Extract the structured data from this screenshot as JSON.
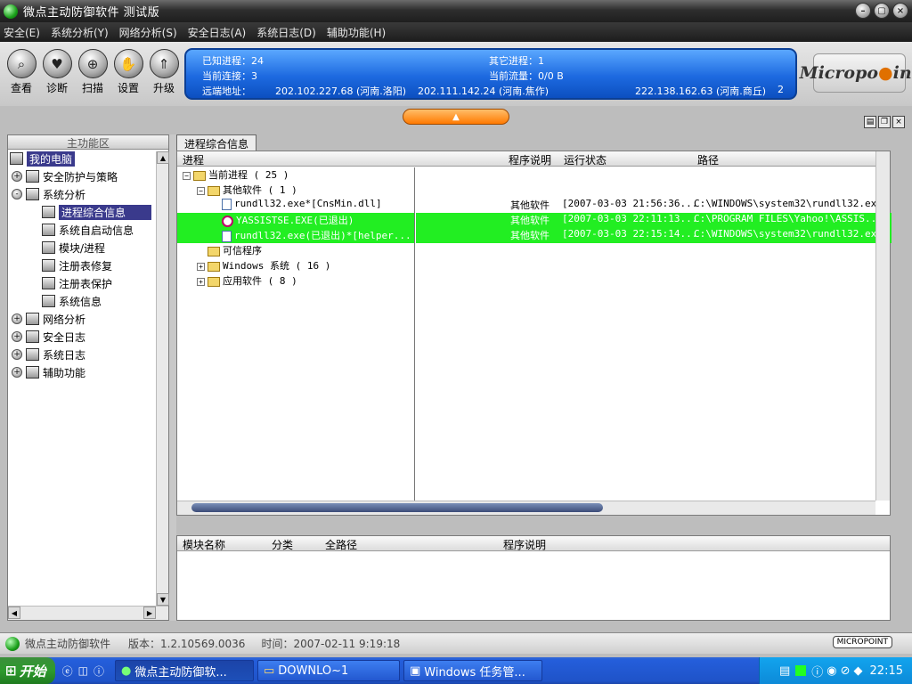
{
  "window": {
    "title": "微点主动防御软件  测试版"
  },
  "menu": [
    "安全(E)",
    "系统分析(Y)",
    "网络分析(S)",
    "安全日志(A)",
    "系统日志(D)",
    "辅助功能(H)"
  ],
  "tools": [
    {
      "label": "查看",
      "icon": "magnifier-icon"
    },
    {
      "label": "诊断",
      "icon": "heart-icon"
    },
    {
      "label": "扫描",
      "icon": "scan-icon"
    },
    {
      "label": "设置",
      "icon": "hand-icon"
    },
    {
      "label": "升级",
      "icon": "upgrade-icon"
    }
  ],
  "info": {
    "known_procs": "已知进程：24",
    "other_procs": "其它进程：1",
    "cur_conn": "当前连接：3",
    "cur_traffic": "当前流量：0/0 B",
    "remote_label": "远端地址：",
    "remote1": "202.102.227.68 (河南.洛阳)",
    "remote2": "202.111.142.24 (河南.焦作)",
    "remote3": "222.138.162.63 (河南.商丘)",
    "remote_count": "2"
  },
  "logo": "Micropoint",
  "left_panel": {
    "title": "主功能区",
    "items": [
      {
        "label": "我的电脑",
        "level": 0,
        "expander": "",
        "selected_root": true
      },
      {
        "label": "安全防护与策略",
        "level": 1,
        "expander": "+"
      },
      {
        "label": "系统分析",
        "level": 1,
        "expander": "-"
      },
      {
        "label": "进程综合信息",
        "level": 2,
        "expander": "",
        "selected": true
      },
      {
        "label": "系统自启动信息",
        "level": 2,
        "expander": ""
      },
      {
        "label": "模块/进程",
        "level": 2,
        "expander": ""
      },
      {
        "label": "注册表修复",
        "level": 2,
        "expander": ""
      },
      {
        "label": "注册表保护",
        "level": 2,
        "expander": ""
      },
      {
        "label": "系统信息",
        "level": 2,
        "expander": ""
      },
      {
        "label": "网络分析",
        "level": 1,
        "expander": "+"
      },
      {
        "label": "安全日志",
        "level": 1,
        "expander": "+"
      },
      {
        "label": "系统日志",
        "level": 1,
        "expander": "+"
      },
      {
        "label": "辅助功能",
        "level": 1,
        "expander": "+"
      }
    ]
  },
  "tab": "进程综合信息",
  "proc_headers": [
    "进程",
    "程序说明",
    "运行状态",
    "路径"
  ],
  "proc_tree": [
    {
      "label": "当前进程 ( 25 )",
      "indent": 0,
      "exp": "-",
      "type": "folder"
    },
    {
      "label": "其他软件 ( 1 )",
      "indent": 1,
      "exp": "-",
      "type": "folder"
    },
    {
      "label": "rundll32.exe*[CnsMin.dll]",
      "indent": 2,
      "exp": "",
      "type": "file",
      "green": false,
      "desc": "其他软件",
      "status": "[2007-03-03 21:56:36...",
      "path": "C:\\WINDOWS\\system32\\rundll32.exe"
    },
    {
      "label": "YASSISTSE.EXE(已退出)",
      "indent": 2,
      "exp": "",
      "type": "stop",
      "green": true,
      "desc": "其他软件",
      "status": "[2007-03-03 22:11:13...",
      "path": "C:\\PROGRAM FILES\\Yahoo!\\ASSIS..."
    },
    {
      "label": "rundll32.exe(已退出)*[helper...",
      "indent": 2,
      "exp": "",
      "type": "file",
      "green": true,
      "desc": "其他软件",
      "status": "[2007-03-03 22:15:14...",
      "path": "C:\\WINDOWS\\system32\\rundll32.exe"
    },
    {
      "label": "可信程序",
      "indent": 1,
      "exp": "",
      "type": "folder"
    },
    {
      "label": "Windows 系统 ( 16 )",
      "indent": 1,
      "exp": "+",
      "type": "folder"
    },
    {
      "label": "应用软件 ( 8 )",
      "indent": 1,
      "exp": "+",
      "type": "folder"
    }
  ],
  "module_headers": [
    "模块名称",
    "分类",
    "全路径",
    "程序说明"
  ],
  "status": {
    "app": "微点主动防御软件",
    "version": "版本：1.2.10569.0036",
    "time": "时间：2007-02-11 9:19:18",
    "badge": "MICROPOINT"
  },
  "taskbar": {
    "start": "开始",
    "tasks": [
      "微点主动防御软...",
      "DOWNLO~1",
      "Windows 任务管..."
    ],
    "clock": "22:15"
  },
  "colors": {
    "highlight": "#22ee22",
    "selected": "#3a3a8c",
    "panel_blue": "#1d6ae0"
  }
}
